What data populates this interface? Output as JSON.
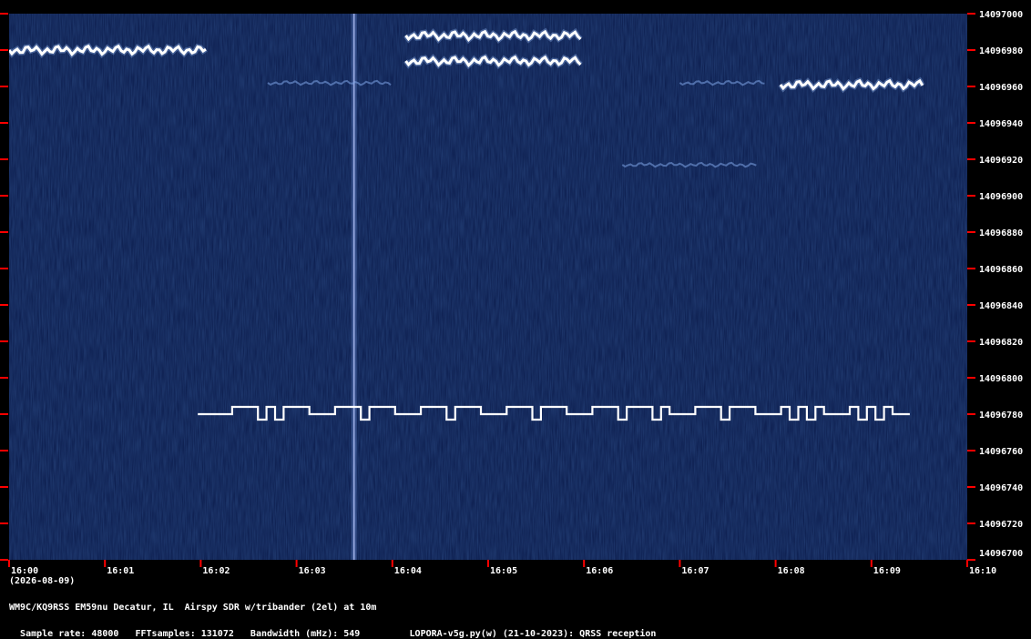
{
  "chart_data": {
    "type": "heatmap",
    "subtype": "qrss-waterfall",
    "x_axis": {
      "tick_labels": [
        "16:00",
        "16:01",
        "16:02",
        "16:03",
        "16:04",
        "16:05",
        "16:06",
        "16:07",
        "16:08",
        "16:09",
        "16:10"
      ],
      "date_label": "(2026-08-09)"
    },
    "y_axis": {
      "unit": "Hz",
      "ylim": [
        14096700,
        14097000
      ],
      "tick_values": [
        14096700,
        14096720,
        14096740,
        14096760,
        14096780,
        14096800,
        14096820,
        14096840,
        14096860,
        14096880,
        14096900,
        14096920,
        14096940,
        14096960,
        14096980,
        14097000
      ]
    },
    "signals": [
      {
        "kind": "fsk-wavy",
        "t_start": 0.0,
        "t_end": 2.06,
        "freq_hz": 14096980
      },
      {
        "kind": "fsk-wavy",
        "t_start": 4.14,
        "t_end": 5.97,
        "freq_hz": 14096988
      },
      {
        "kind": "fsk-wavy",
        "t_start": 4.14,
        "t_end": 5.97,
        "freq_hz": 14096974
      },
      {
        "kind": "faint",
        "t_start": 2.7,
        "t_end": 4.0,
        "freq_hz": 14096962
      },
      {
        "kind": "faint",
        "t_start": 7.0,
        "t_end": 7.9,
        "freq_hz": 14096962
      },
      {
        "kind": "fsk-wavy",
        "t_start": 8.05,
        "t_end": 9.55,
        "freq_hz": 14096961
      },
      {
        "kind": "faint",
        "t_start": 6.4,
        "t_end": 7.8,
        "freq_hz": 14096917
      },
      {
        "kind": "fsk-steps",
        "t_start": 1.97,
        "t_end": 9.4,
        "base_hz": 14096780,
        "high_hz": 14096784,
        "low_hz": 14096777,
        "pattern": "BBBBHHHLHLHHHBBBHHHLHHHBBBHHHLHHHBBBHHHLHHHBBBHHHLHHHLHBBBHHHLHHHBBBHLHLHBBBHLHLHBB"
      }
    ],
    "vertical_line": {
      "t": 3.6
    }
  },
  "colors": {
    "background": "#0a1a4a",
    "signal": "#ffffff",
    "tick": "#ff0000",
    "frame": "#000000"
  },
  "footer": {
    "line1": "WM9C/KQ9RSS EM59nu Decatur, IL  Airspy SDR w/tribander (2el) at 10m",
    "sample_rate": "Sample rate: 48000",
    "fft_samples": "FFTsamples: 131072",
    "bandwidth": "Bandwidth (mHz): 549",
    "software": "LOPORA-v5g.py(w) (21-10-2023): QRSS reception"
  }
}
